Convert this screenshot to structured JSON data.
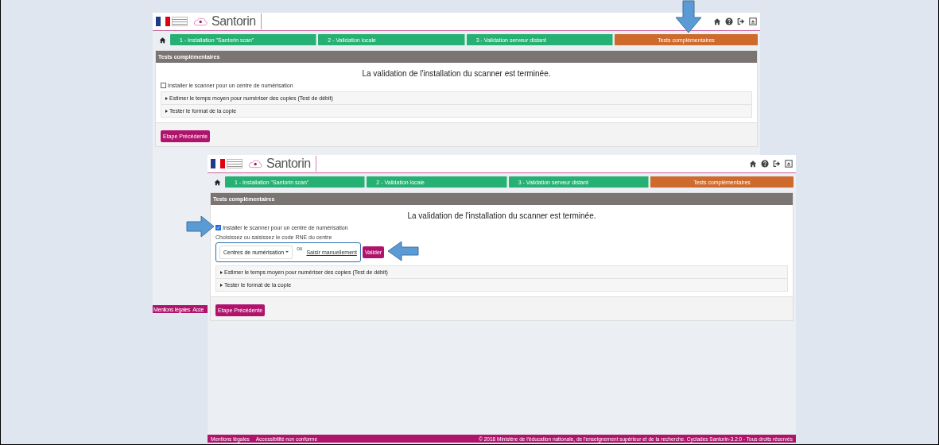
{
  "screens": [
    {
      "header": {
        "app_name": "Santorin"
      },
      "steps": [
        {
          "label": "1 - Installation \"Santorin scan\"",
          "selected": false
        },
        {
          "label": "2 - Validation locale",
          "selected": false
        },
        {
          "label": "3 - Validation serveur distant",
          "selected": false
        },
        {
          "label": "Tests complémentaires",
          "selected": true
        }
      ],
      "panel_title": "Tests complémentaires",
      "message": "La validation de l'installation du scanner est terminée.",
      "centre_option": {
        "label": "Installer le scanner pour un centre de numérisation",
        "checked": false
      },
      "sections": [
        {
          "label": "Estimer le temps moyen pour numériser des copies (Test de débit)",
          "expanded": false
        },
        {
          "label": "Tester le format de la copie",
          "expanded": false
        }
      ],
      "back_button": "Etape Précédente",
      "footer": {
        "links": [
          "Mentions légales",
          "Acce"
        ]
      }
    },
    {
      "header": {
        "app_name": "Santorin"
      },
      "steps": [
        {
          "label": "1 - Installation \"Santorin scan\"",
          "selected": false
        },
        {
          "label": "2 - Validation locale",
          "selected": false
        },
        {
          "label": "3 - Validation serveur distant",
          "selected": false
        },
        {
          "label": "Tests complémentaires",
          "selected": true
        }
      ],
      "panel_title": "Tests complémentaires",
      "message": "La validation de l'installation du scanner est terminée.",
      "centre_option": {
        "label": "Installer le scanner pour un centre de numérisation",
        "checked": true
      },
      "rne_form": {
        "prompt": "Choisissez ou saisissez le code RNE du centre",
        "dropdown": "Centres de numérisation",
        "or": "ou",
        "manual_link": "Saisir manuellement",
        "submit": "Valider"
      },
      "sections": [
        {
          "label": "Estimer le temps moyen pour numériser des copies (Test de débit)",
          "expanded": false
        },
        {
          "label": "Tester le format de la copie",
          "expanded": false
        }
      ],
      "back_button": "Etape Précédente",
      "footer": {
        "links": [
          "Mentions légales",
          "Accessibilité non conforme"
        ],
        "copyright": "© 2018 Ministère de l'éducation nationale, de l'enseignement supérieur et de la recherche. Cyclades Santorin-3.2.0 - Tous droits réservés"
      }
    }
  ]
}
